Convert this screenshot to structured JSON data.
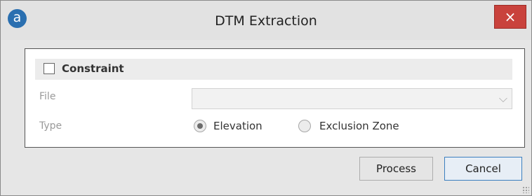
{
  "window": {
    "title": "DTM Extraction",
    "logo_letter": "a",
    "close_symbol": "×"
  },
  "constraint": {
    "label": "Constraint",
    "checked": false
  },
  "fields": {
    "file_label": "File",
    "file_value": "",
    "type_label": "Type"
  },
  "type_options": [
    {
      "label": "Elevation",
      "selected": true
    },
    {
      "label": "Exclusion Zone",
      "selected": false
    }
  ],
  "buttons": {
    "process": "Process",
    "cancel": "Cancel"
  },
  "icons": {
    "logo": "app-logo-icon",
    "close": "close-icon",
    "dropdown": "chevron-down-icon",
    "resize": "resize-grip-icon"
  },
  "colors": {
    "close_button": "#c9423c",
    "logo": "#2a6fb0",
    "default_button_border": "#3c7fbf"
  }
}
